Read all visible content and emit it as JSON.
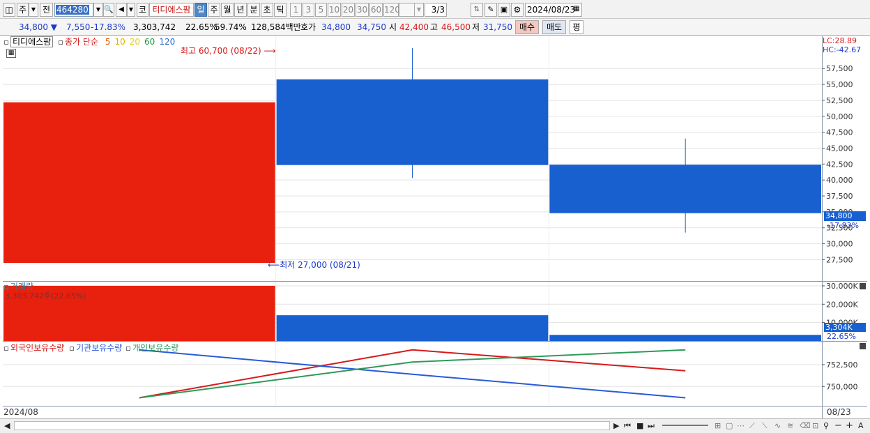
{
  "toolbar": {
    "market_label": "주",
    "prev_label": "전",
    "stock_code": "464280",
    "stock_name": "티디에스팜",
    "code_btn": "코",
    "periods": [
      "일",
      "주",
      "월",
      "년",
      "분",
      "초",
      "틱"
    ],
    "selected_period": "일",
    "intervals": [
      "1",
      "3",
      "5",
      "10",
      "20",
      "30",
      "60",
      "120"
    ],
    "page_display": "3/3",
    "date": "2024/08/23"
  },
  "quote": {
    "price": "34,800 ▼",
    "change": "7,550",
    "change_pct": "-17.83%",
    "volume": "3,303,742",
    "vol_ratio": "22.65%",
    "turnover_pct": "59.74%",
    "amount": "128,584백만",
    "hoga_label": "호가",
    "ask": "34,800",
    "bid": "34,750",
    "open_label": "시",
    "open": "42,400",
    "high_label": "고",
    "high": "46,500",
    "low_label": "저",
    "low": "31,750",
    "buy_label": "매수",
    "sell_label": "매도",
    "avg_label": "평"
  },
  "price_panel": {
    "legend_name": "티디에스팜",
    "legend_type": "종가 단순",
    "ma": [
      {
        "label": "5",
        "color": "#e06000"
      },
      {
        "label": "10",
        "color": "#e0b000"
      },
      {
        "label": "20",
        "color": "#e6d000"
      },
      {
        "label": "60",
        "color": "#1a9a3a"
      },
      {
        "label": "120",
        "color": "#2a6ad0"
      }
    ],
    "max_annotation": "최고 60,700 (08/22)",
    "min_annotation": "최저 27,000 (08/21)",
    "lc": "LC:28.89",
    "hc": "HC:-42.67",
    "current_price_tag": "34,800",
    "current_pct_tag": "-17.83%",
    "y_ticks": [
      "57,500",
      "55,000",
      "52,500",
      "50,000",
      "47,500",
      "45,000",
      "42,500",
      "40,000",
      "37,500",
      "35,000",
      "32,500",
      "30,000",
      "27,500"
    ]
  },
  "volume_panel": {
    "title": "거래량",
    "value_label": "3,303,742주(22.65%)",
    "y_ticks": [
      "30,000K",
      "20,000K",
      "10,000K"
    ],
    "current_tag": "3,304K",
    "current_pct_tag": "22.65%"
  },
  "holding_panel": {
    "series_labels": [
      "외국인보유수량",
      "기관보유수량",
      "개인보유수량"
    ],
    "y_ticks": [
      "752,500",
      "750,000"
    ]
  },
  "x_axis": {
    "left_label": "2024/08",
    "right_label": "08/23"
  },
  "chart_data": {
    "type": "candlestick",
    "categories": [
      "08/21",
      "08/22",
      "08/23"
    ],
    "candles": [
      {
        "date": "08/21",
        "open": 27000,
        "high": 52200,
        "low": 27000,
        "close": 52200,
        "color": "#e8200e"
      },
      {
        "date": "08/22",
        "open": 55800,
        "high": 60700,
        "low": 40300,
        "close": 42350,
        "color": "#1860d0"
      },
      {
        "date": "08/23",
        "open": 42400,
        "high": 46500,
        "low": 31750,
        "close": 34800,
        "color": "#1860d0"
      }
    ],
    "volume": [
      {
        "date": "08/21",
        "value": 30000000,
        "color": "#e8200e"
      },
      {
        "date": "08/22",
        "value": 14000000,
        "color": "#1860d0"
      },
      {
        "date": "08/23",
        "value": 3303742,
        "color": "#1860d0"
      }
    ],
    "holdings": [
      {
        "name": "외국인보유수량",
        "color": "#d61a1a",
        "values": [
          748700,
          754200,
          751800
        ]
      },
      {
        "name": "기관보유수량",
        "color": "#2a5ad8",
        "values": [
          754200,
          751400,
          748700
        ]
      },
      {
        "name": "개인보유수량",
        "color": "#2e9a5a",
        "values": [
          748700,
          752800,
          754200
        ]
      }
    ],
    "ylim_price": [
      25500,
      60900
    ],
    "ylim_volume": [
      0,
      31500000
    ],
    "ylim_holdings": [
      748100,
      754900
    ]
  }
}
